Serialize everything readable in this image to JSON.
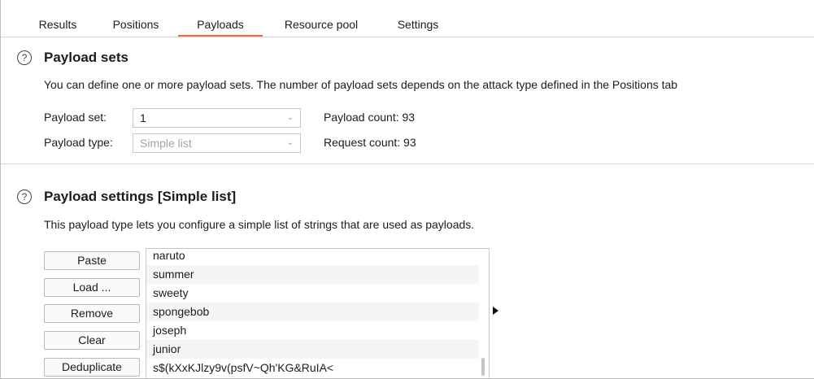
{
  "tabs": [
    {
      "label": "Results"
    },
    {
      "label": "Positions"
    },
    {
      "label": "Payloads",
      "active": true
    },
    {
      "label": "Resource pool"
    },
    {
      "label": "Settings"
    }
  ],
  "help_icon_glyph": "?",
  "payload_sets": {
    "title": "Payload sets",
    "description": "You can define one or more payload sets. The number of payload sets depends on the attack type defined in the Positions tab",
    "payload_set_label": "Payload set:",
    "payload_set_value": "1",
    "payload_type_label": "Payload type:",
    "payload_type_value": "Simple list",
    "payload_count": "Payload count: 93",
    "request_count": "Request count: 93"
  },
  "payload_settings": {
    "title": "Payload settings [Simple list]",
    "description": "This payload type lets you configure a simple list of strings that are used as payloads.",
    "buttons": {
      "paste": "Paste",
      "load": "Load ...",
      "remove": "Remove",
      "clear": "Clear",
      "deduplicate": "Deduplicate"
    },
    "items": [
      "naruto",
      "summer",
      "sweety",
      "spongebob",
      "joseph",
      "junior",
      "s$(kXxKJlzy9v(psfV~Qh'KG&RuIA<"
    ]
  },
  "icons": {
    "help": "help-circle-icon",
    "dropdown": "chevron-down-icon",
    "expand": "triangle-right-icon"
  },
  "colors": {
    "active_tab_underline": "#ff6633",
    "alt_row": "#f5f5f5"
  }
}
